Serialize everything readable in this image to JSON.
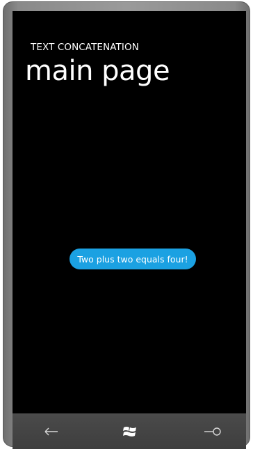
{
  "app": {
    "title": "TEXT CONCATENATION",
    "page_title": "main page"
  },
  "content": {
    "message": "Two plus two equals four!"
  },
  "nav": {
    "back_icon": "back-arrow-icon",
    "start_icon": "windows-logo-icon",
    "search_icon": "search-icon"
  },
  "colors": {
    "accent": "#1ba1e2",
    "background": "#000000",
    "foreground": "#ffffff",
    "nav_bar": "#404040"
  }
}
